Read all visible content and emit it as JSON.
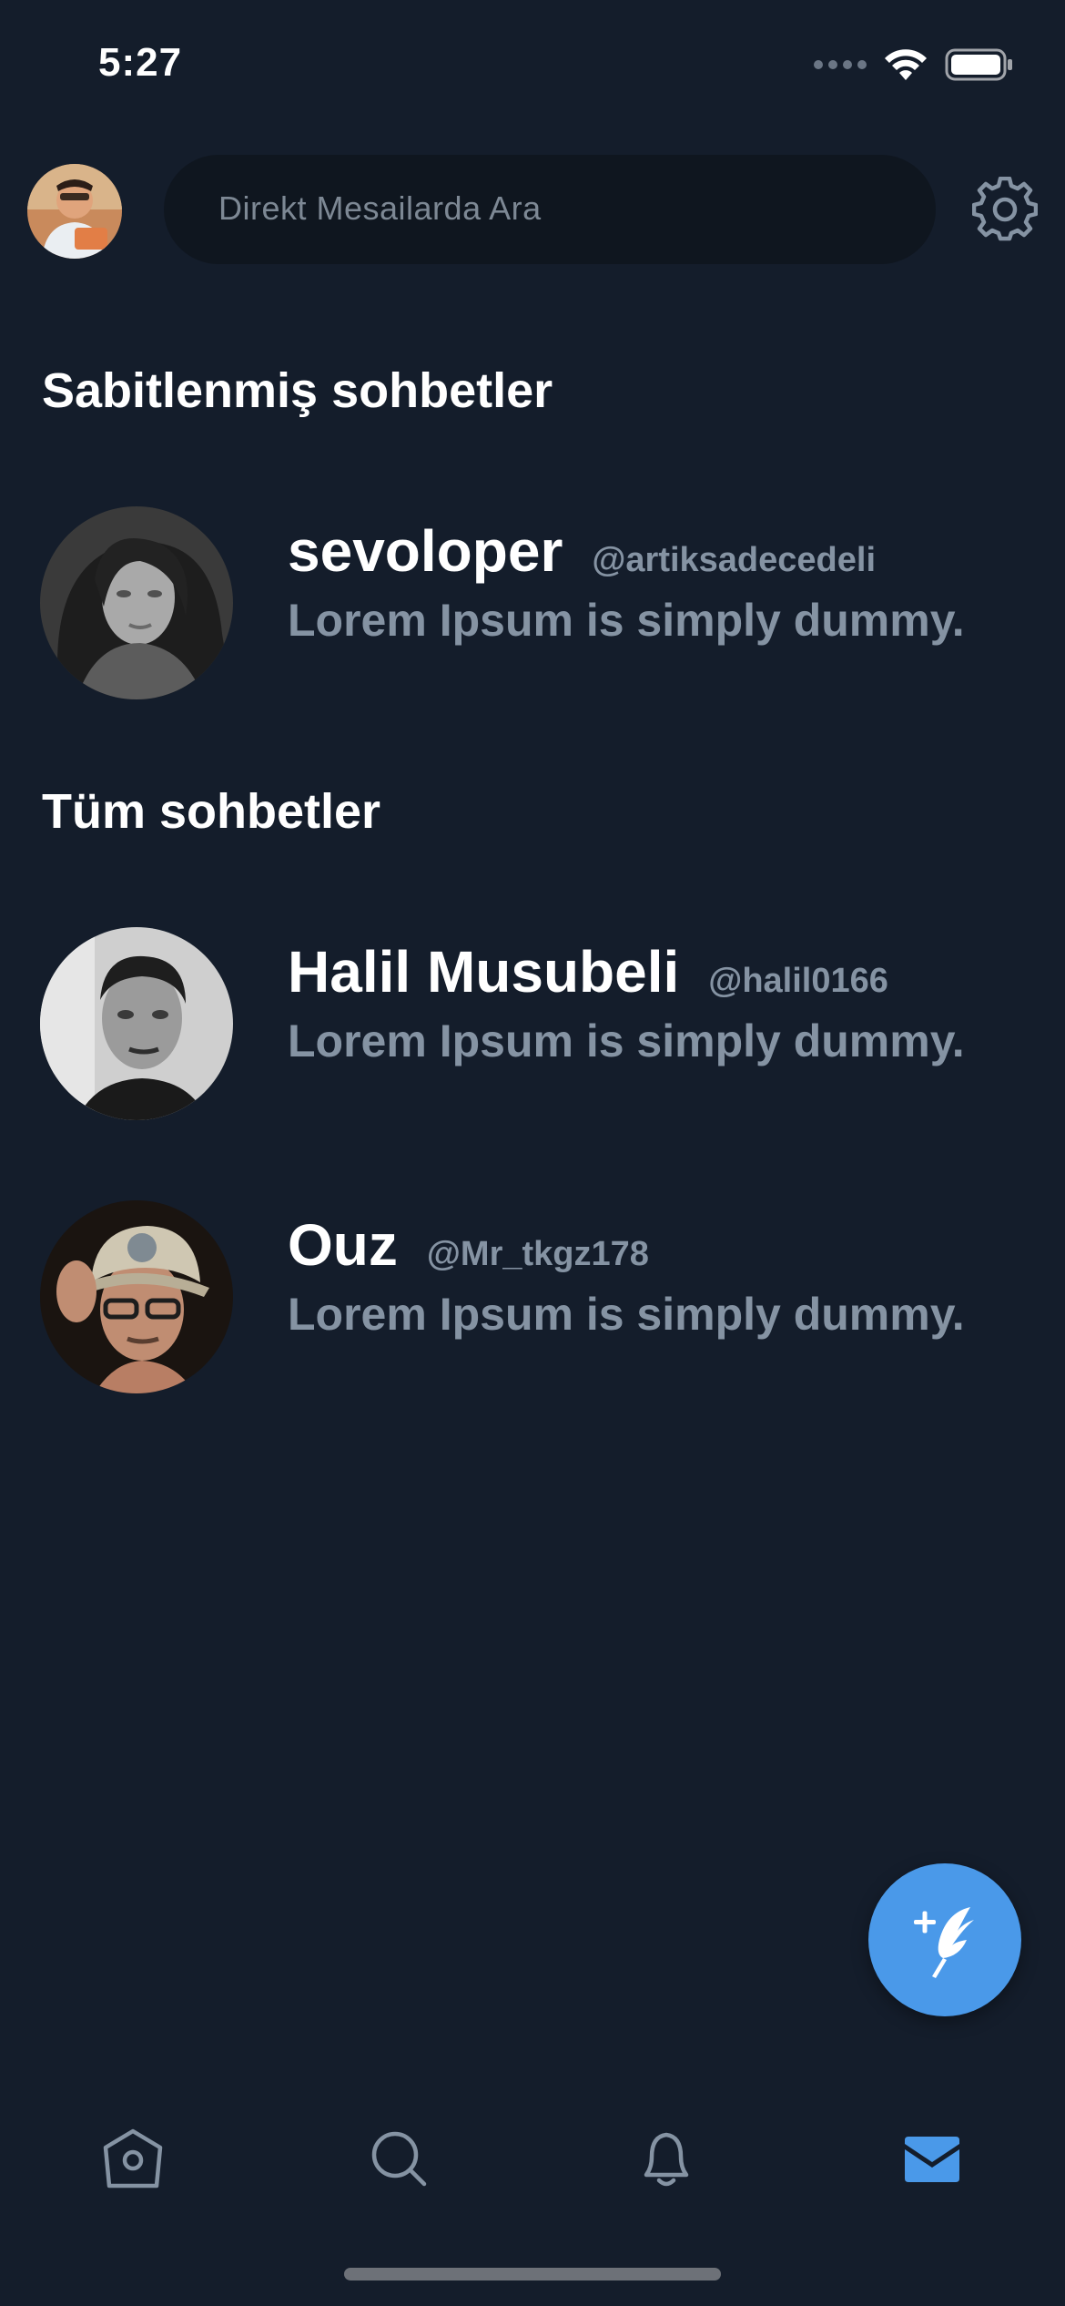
{
  "status_bar": {
    "time": "5:27"
  },
  "header": {
    "search_placeholder": "Direkt Mesailarda Ara"
  },
  "sections": {
    "pinned_title": "Sabitlenmiş sohbetler",
    "all_title": "Tüm sohbetler"
  },
  "pinned_chats": [
    {
      "name": "sevoloper",
      "handle": "@artiksadecedeli",
      "preview": "Lorem Ipsum is simply dummy."
    }
  ],
  "all_chats": [
    {
      "name": "Halil Musubeli",
      "handle": "@halil0166",
      "preview": "Lorem Ipsum is simply dummy."
    },
    {
      "name": "Ouz",
      "handle": "@Mr_tkgz178",
      "preview": "Lorem Ipsum is simply dummy."
    }
  ],
  "tab_bar": {
    "tabs": [
      {
        "icon": "home-icon",
        "active": false
      },
      {
        "icon": "search-icon",
        "active": false
      },
      {
        "icon": "bell-icon",
        "active": false
      },
      {
        "icon": "mail-icon",
        "active": true
      }
    ]
  },
  "colors": {
    "background": "#141d2b",
    "search_bg": "#0f161f",
    "accent": "#4a99e9",
    "muted_text": "#8593a3",
    "inactive_icon": "#8593a3"
  }
}
